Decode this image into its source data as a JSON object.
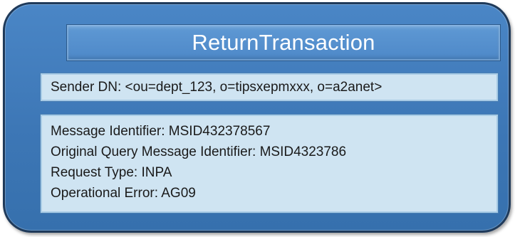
{
  "title": "ReturnTransaction",
  "sender": {
    "text": "Sender DN: <ou=dept_123, o=tipsxepmxxx, o=a2anet>"
  },
  "details": {
    "lines": [
      "Message Identifier: MSID432378567",
      "Original Query Message Identifier: MSID4323786",
      "Request Type: INPA",
      "Operational Error: AG09"
    ]
  },
  "colors": {
    "frame": "#3d77b6",
    "title_bar": "#4d88c8",
    "content_box": "#cfe4f2"
  }
}
